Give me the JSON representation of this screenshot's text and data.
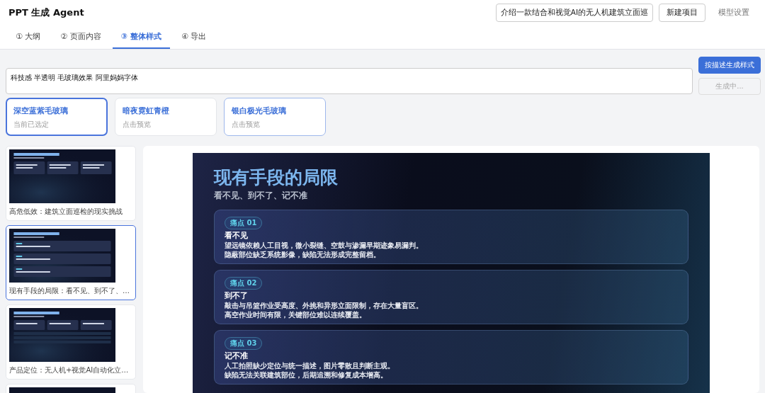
{
  "header": {
    "title": "PPT 生成 Agent",
    "topic_field": {
      "value": "介绍一款结合和视觉AI的无人机建筑立面巡"
    },
    "buttons": [
      {
        "label": "新建项目",
        "kind": "outlined"
      },
      {
        "label": "模型设置",
        "kind": "text"
      }
    ]
  },
  "tabs": [
    {
      "label": "① 大纲",
      "selected": false
    },
    {
      "label": "② 页面内容",
      "selected": false
    },
    {
      "label": "③ 整体样式",
      "selected": true
    },
    {
      "label": "④ 导出",
      "selected": false
    }
  ],
  "style_prompt": {
    "value": "科技感 半透明 毛玻璃效果 阿里妈妈字体"
  },
  "actions": [
    {
      "label": "按描述生成样式",
      "disabled": false
    },
    {
      "label": "生成中...",
      "disabled": true
    }
  ],
  "style_options": [
    {
      "name": "深空蓝紫毛玻璃",
      "note": "当前已选定",
      "selected": true,
      "hovered": false
    },
    {
      "name": "暗夜霓虹青橙",
      "note": "点击预览",
      "selected": false,
      "hovered": false
    },
    {
      "name": "银白极光毛玻璃",
      "note": "点击预览",
      "selected": false,
      "hovered": true
    }
  ],
  "thumbnails": [
    {
      "caption": "高危低效：建筑立面巡检的现实挑战",
      "selected": false
    },
    {
      "caption": "现有手段的局限：看不见、到不了、…",
      "selected": true
    },
    {
      "caption": "产品定位：无人机+视觉AI自动化立…",
      "selected": false
    },
    {
      "selected": false
    }
  ],
  "slide": {
    "title": "现有手段的局限",
    "subtitle": "看不见、到不了、记不准",
    "points": [
      {
        "badge": "痛点 01",
        "heading": "看不见",
        "lines": [
          "望远镜依赖人工目视，微小裂缝、空鼓与渗漏早期迹象易漏判。",
          "隐蔽部位缺乏系统影像，缺陷无法形成完整留档。"
        ]
      },
      {
        "badge": "痛点 02",
        "heading": "到不了",
        "lines": [
          "敲击与吊篮作业受高度、外挑和异形立面限制，存在大量盲区。",
          "高空作业时间有限，关键部位难以连续覆盖。"
        ]
      },
      {
        "badge": "痛点 03",
        "heading": "记不准",
        "lines": [
          "人工拍照缺少定位与统一描述，图片零散且判断主观。",
          "缺陷无法关联建筑部位，后期追溯和修复成本增高。"
        ]
      }
    ]
  }
}
